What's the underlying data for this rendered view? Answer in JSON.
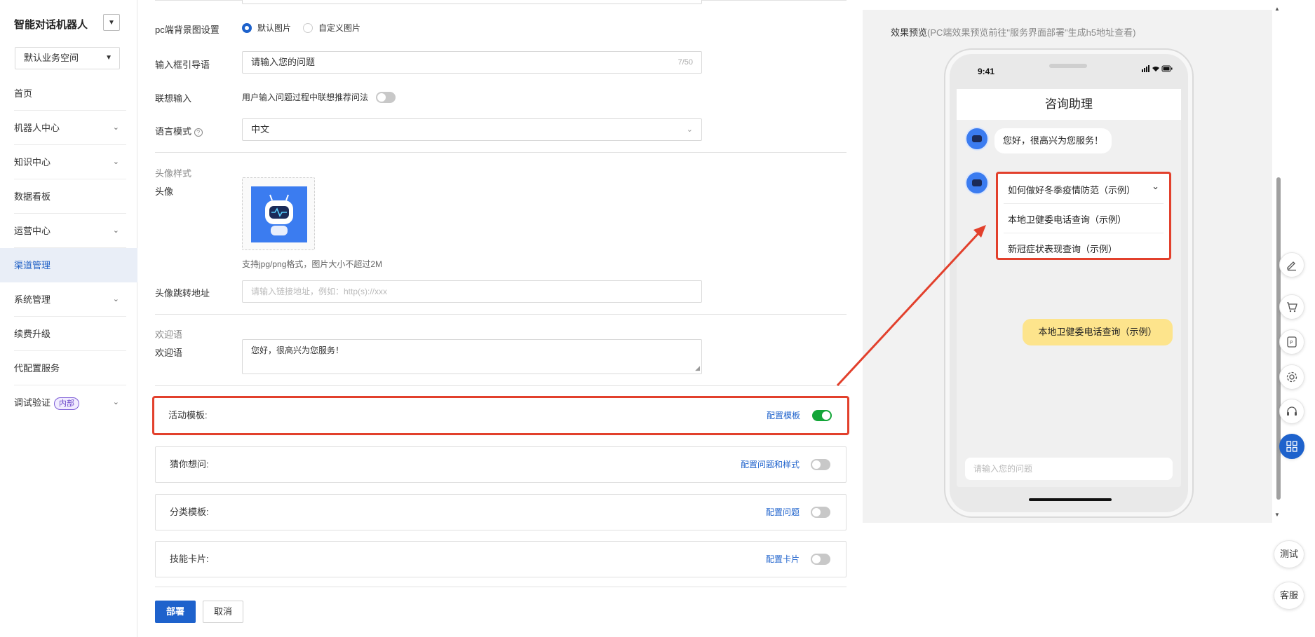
{
  "sidebar": {
    "app_title": "智能对话机器人",
    "workspace": "默认业务空间",
    "items": [
      {
        "label": "首页",
        "has_children": false,
        "active": false
      },
      {
        "label": "机器人中心",
        "has_children": true,
        "active": false
      },
      {
        "label": "知识中心",
        "has_children": true,
        "active": false
      },
      {
        "label": "数据看板",
        "has_children": false,
        "active": false
      },
      {
        "label": "运营中心",
        "has_children": true,
        "active": false
      },
      {
        "label": "渠道管理",
        "has_children": false,
        "active": true
      },
      {
        "label": "系统管理",
        "has_children": true,
        "active": false
      },
      {
        "label": "续费升级",
        "has_children": false,
        "active": false
      },
      {
        "label": "代配置服务",
        "has_children": false,
        "active": false
      },
      {
        "label": "调试验证",
        "has_children": true,
        "active": false,
        "badge": "内部"
      }
    ]
  },
  "form": {
    "bg_setting": {
      "label": "pc端背景图设置",
      "option_default": "默认图片",
      "option_custom": "自定义图片",
      "selected": "默认图片"
    },
    "guide": {
      "label": "输入框引导语",
      "value": "请输入您的问题",
      "count": "7/50"
    },
    "assoc": {
      "label": "联想输入",
      "desc": "用户输入问题过程中联想推荐问法",
      "enabled": false
    },
    "lang": {
      "label": "语言模式",
      "value": "中文"
    },
    "avatar_section": {
      "title": "头像样式",
      "label": "头像",
      "hint": "支持jpg/png格式，图片大小不超过2M"
    },
    "avatar_link": {
      "label": "头像跳转地址",
      "placeholder": "请输入链接地址，例如：http(s)://xxx"
    },
    "welcome_section": {
      "title": "欢迎语",
      "label": "欢迎语",
      "value": "您好，很高兴为您服务！"
    },
    "cards": [
      {
        "label": "活动模板:",
        "link": "配置模板",
        "enabled": true
      },
      {
        "label": "猜你想问:",
        "link": "配置问题和样式",
        "enabled": false
      },
      {
        "label": "分类模板:",
        "link": "配置问题",
        "enabled": false
      },
      {
        "label": "技能卡片:",
        "link": "配置卡片",
        "enabled": false
      }
    ],
    "deploy_label": "部署",
    "cancel_label": "取消"
  },
  "preview": {
    "title": "效果预览",
    "note": "(PC端效果预览前往\"服务界面部署\"生成h5地址查看)",
    "phone_time": "9:41",
    "chat_title": "咨询助理",
    "greeting": "您好，很高兴为您服务！",
    "questions": [
      "如何做好冬季疫情防范（示例）",
      "本地卫健委电话查询（示例）",
      "新冠症状表现查询（示例）"
    ],
    "user_message": "本地卫健委电话查询（示例）",
    "input_placeholder": "请输入您的问题"
  },
  "tools": {
    "test_label": "测试",
    "service_label": "客服",
    "icons": [
      "edit-icon",
      "cart-icon",
      "app-icon",
      "gear-icon",
      "headset-icon",
      "grid-icon"
    ]
  },
  "colors": {
    "accent": "#1e62cc",
    "highlight": "#e2402c",
    "toggle_on": "#13a538",
    "user_bubble": "#fde48c"
  }
}
